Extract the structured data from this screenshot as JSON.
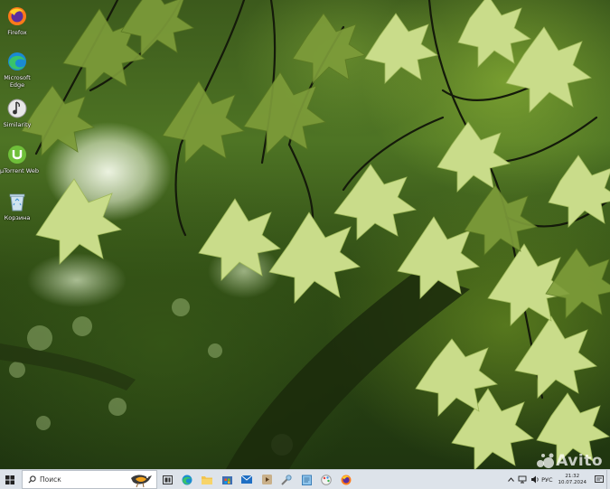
{
  "desktop": {
    "icons": [
      {
        "label": "Firefox",
        "icon": "firefox-icon"
      },
      {
        "label": "Microsoft Edge",
        "icon": "edge-icon"
      },
      {
        "label": "Similarity",
        "icon": "similarity-icon"
      },
      {
        "label": "µTorrent Web",
        "icon": "utorrent-icon"
      },
      {
        "label": "Корзина",
        "icon": "recycle-bin-icon"
      }
    ]
  },
  "taskbar": {
    "search_placeholder": "Поиск",
    "pinned": [
      "task-view-icon",
      "edge-icon",
      "file-explorer-icon",
      "store-icon",
      "mail-icon",
      "media-icon",
      "tools-icon",
      "notepad-icon",
      "paint-icon",
      "firefox-icon"
    ],
    "tray": {
      "language": "РУС",
      "time": "21:32",
      "date": "10.07.2024"
    }
  },
  "watermark": {
    "text": "Avito"
  },
  "colors": {
    "taskbar": "#dde3ea",
    "edge_blue": "#1a8ad4",
    "firefox_orange": "#ff7a1a",
    "utorrent_green": "#6fbf3a"
  }
}
